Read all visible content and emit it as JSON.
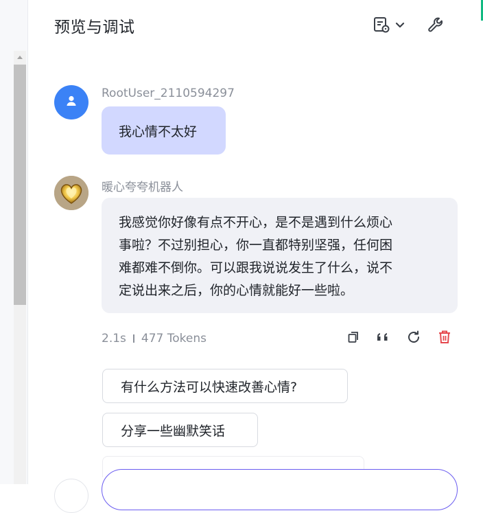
{
  "header": {
    "title": "预览与调试",
    "history_icon": "document-settings-icon",
    "dropdown_icon": "chevron-down-icon",
    "tools_icon": "wrench-icon"
  },
  "conversation": {
    "user_message": {
      "username": "RootUser_2110594297",
      "text": "我心情不太好",
      "avatar_icon": "user-icon",
      "avatar_color": "#3b82f6",
      "bubble_color": "#d2d8ff"
    },
    "bot_message": {
      "name": "暖心夸夸机器人",
      "avatar_icon": "golden-heart-icon",
      "lines": [
        "我感觉你好像有点不开心，是不是遇到什么烦心",
        "事啦？不过别担心，你一直都特别坚强，任何困",
        "难都难不倒你。可以跟我说说发生了什么，说不",
        "定说出来之后，你的心情就能好一些啦。"
      ],
      "duration": "2.1s",
      "tokens": "477 Tokens",
      "actions": [
        "copy-icon",
        "quote-icon",
        "regenerate-icon",
        "delete-icon"
      ],
      "delete_color": "#e5484d"
    },
    "suggestions": [
      "有什么方法可以快速改善心情?",
      "分享一些幽默笑话"
    ]
  },
  "composer": {
    "border_color": "#6a5cf0"
  }
}
